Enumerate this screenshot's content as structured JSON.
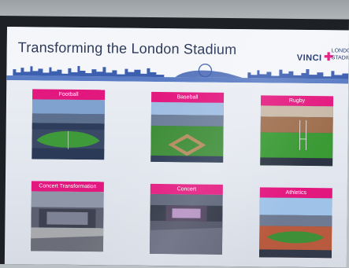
{
  "slide": {
    "title": "Transforming the London Stadium",
    "brand": {
      "vinci": "VINCI",
      "partner": "LONDON STADIUM",
      "accent_color": "#e3187f",
      "navy_color": "#1a2f6e"
    }
  },
  "tiles": [
    {
      "label": "Football",
      "icon": "football-pitch-photo"
    },
    {
      "label": "Baseball",
      "icon": "baseball-diamond-photo"
    },
    {
      "label": "Rugby",
      "icon": "rugby-pitch-photo"
    },
    {
      "label": "Concert Transformation",
      "icon": "concert-transformation-photo"
    },
    {
      "label": "Concert",
      "icon": "concert-crowd-photo"
    },
    {
      "label": "Athletics",
      "icon": "athletics-track-photo"
    }
  ]
}
